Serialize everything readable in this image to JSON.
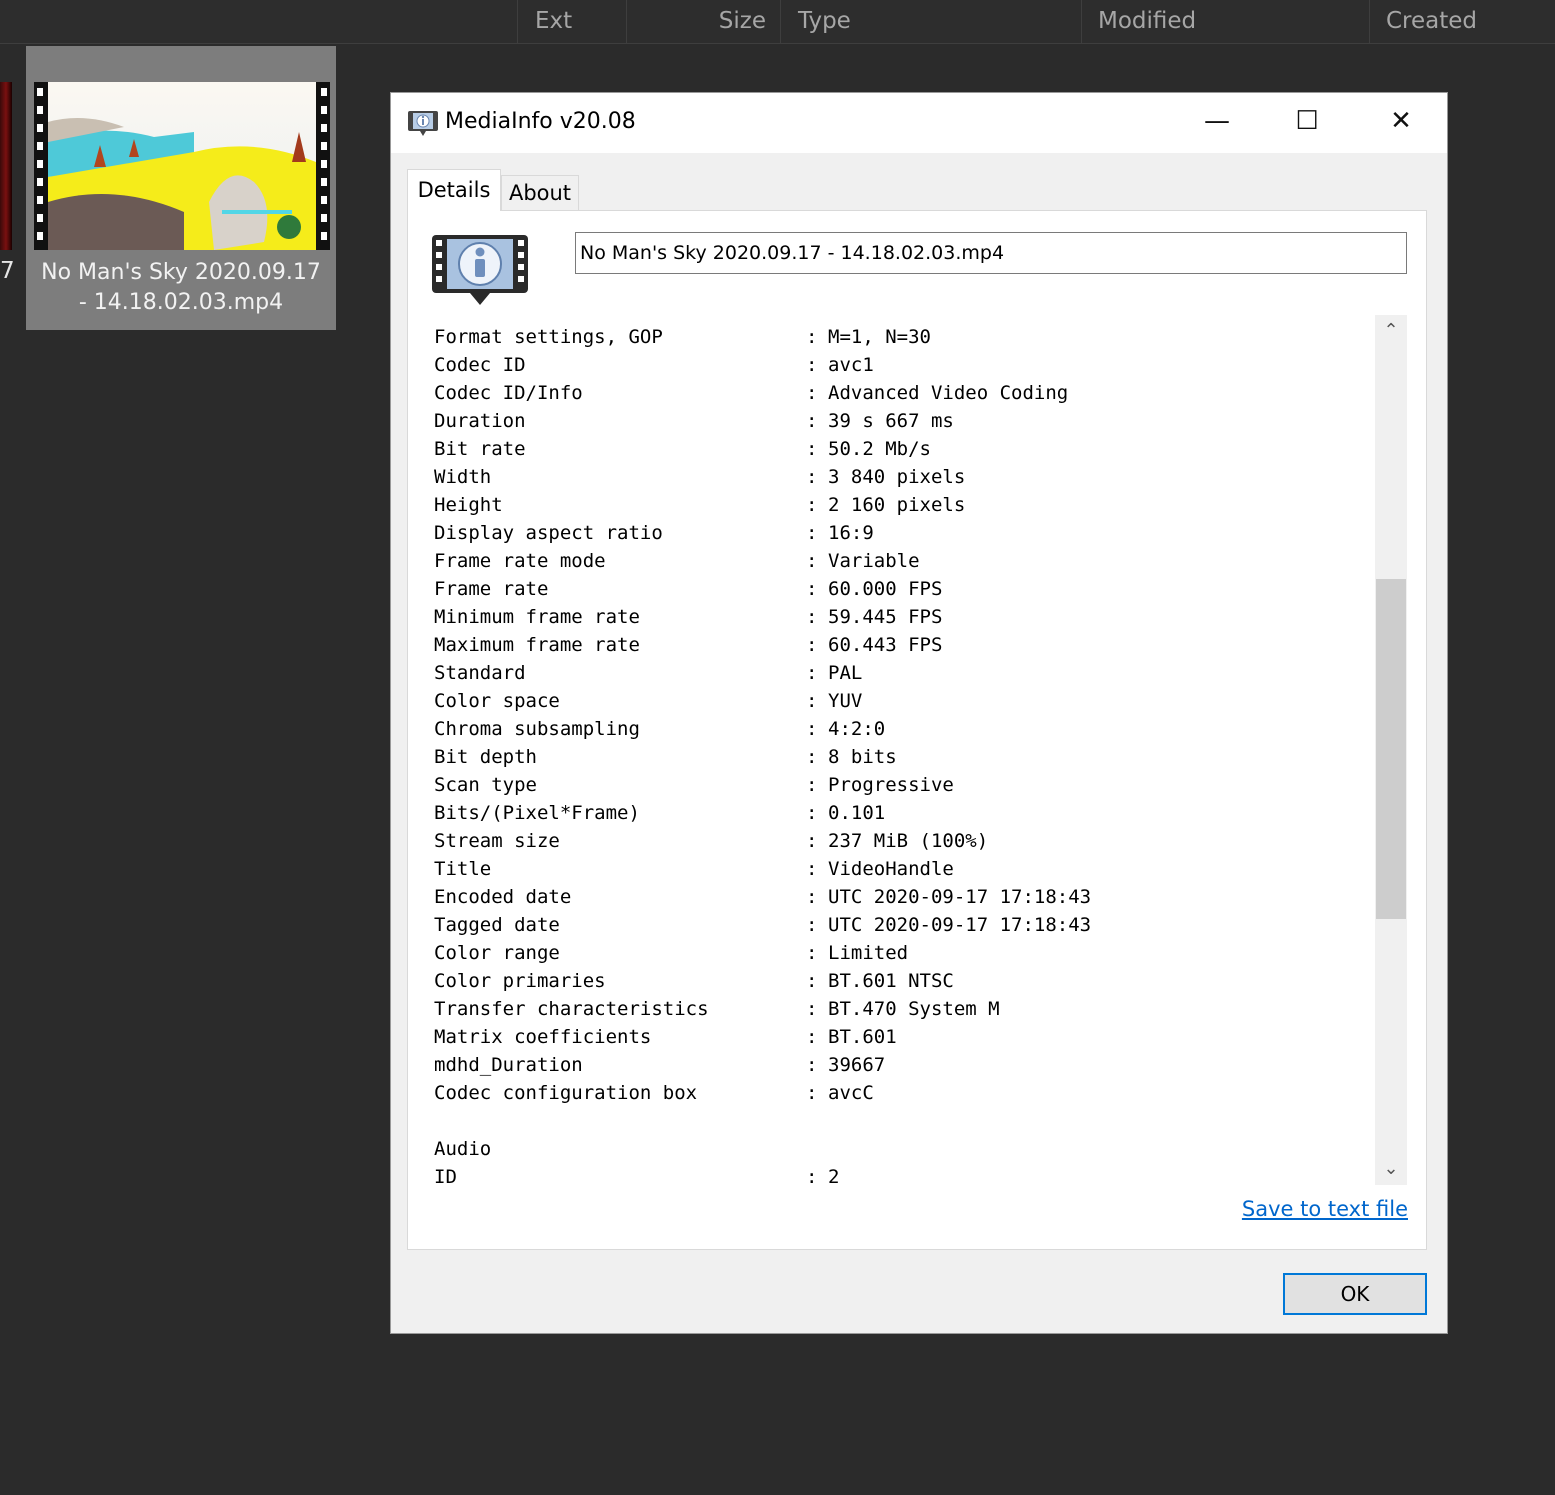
{
  "browser": {
    "columns": [
      {
        "label": "Ext"
      },
      {
        "label": "Size"
      },
      {
        "label": "Type"
      },
      {
        "label": "Modified"
      },
      {
        "label": "Created"
      }
    ],
    "partial_item_label": "7",
    "selected_item": {
      "name_line1": "No Man's Sky 2020.09.17",
      "name_line2": "- 14.18.02.03.mp4"
    }
  },
  "dialog": {
    "title": "MediaInfo v20.08",
    "window_buttons": {
      "minimize": "—",
      "maximize": "☐",
      "close": "✕"
    },
    "tabs": [
      {
        "label": "Details"
      },
      {
        "label": "About"
      }
    ],
    "filename": "No Man's Sky 2020.09.17 - 14.18.02.03.mp4",
    "info_lines": [
      {
        "key": "Format settings, GOP",
        "value": "M=1, N=30"
      },
      {
        "key": "Codec ID",
        "value": "avc1"
      },
      {
        "key": "Codec ID/Info",
        "value": "Advanced Video Coding"
      },
      {
        "key": "Duration",
        "value": "39 s 667 ms"
      },
      {
        "key": "Bit rate",
        "value": "50.2 Mb/s"
      },
      {
        "key": "Width",
        "value": "3 840 pixels"
      },
      {
        "key": "Height",
        "value": "2 160 pixels"
      },
      {
        "key": "Display aspect ratio",
        "value": "16:9"
      },
      {
        "key": "Frame rate mode",
        "value": "Variable"
      },
      {
        "key": "Frame rate",
        "value": "60.000 FPS"
      },
      {
        "key": "Minimum frame rate",
        "value": "59.445 FPS"
      },
      {
        "key": "Maximum frame rate",
        "value": "60.443 FPS"
      },
      {
        "key": "Standard",
        "value": "PAL"
      },
      {
        "key": "Color space",
        "value": "YUV"
      },
      {
        "key": "Chroma subsampling",
        "value": "4:2:0"
      },
      {
        "key": "Bit depth",
        "value": "8 bits"
      },
      {
        "key": "Scan type",
        "value": "Progressive"
      },
      {
        "key": "Bits/(Pixel*Frame)",
        "value": "0.101"
      },
      {
        "key": "Stream size",
        "value": "237 MiB (100%)"
      },
      {
        "key": "Title",
        "value": "VideoHandle"
      },
      {
        "key": "Encoded date",
        "value": "UTC 2020-09-17 17:18:43"
      },
      {
        "key": "Tagged date",
        "value": "UTC 2020-09-17 17:18:43"
      },
      {
        "key": "Color range",
        "value": "Limited"
      },
      {
        "key": "Color primaries",
        "value": "BT.601 NTSC"
      },
      {
        "key": "Transfer characteristics",
        "value": "BT.470 System M"
      },
      {
        "key": "Matrix coefficients",
        "value": "BT.601"
      },
      {
        "key": "mdhd_Duration",
        "value": "39667"
      },
      {
        "key": "Codec configuration box",
        "value": "avcC"
      },
      {
        "key": "",
        "value": ""
      },
      {
        "key": "Audio",
        "value": ""
      },
      {
        "key": "ID",
        "value": "2"
      }
    ],
    "save_link": "Save to text file",
    "ok_label": "OK"
  }
}
